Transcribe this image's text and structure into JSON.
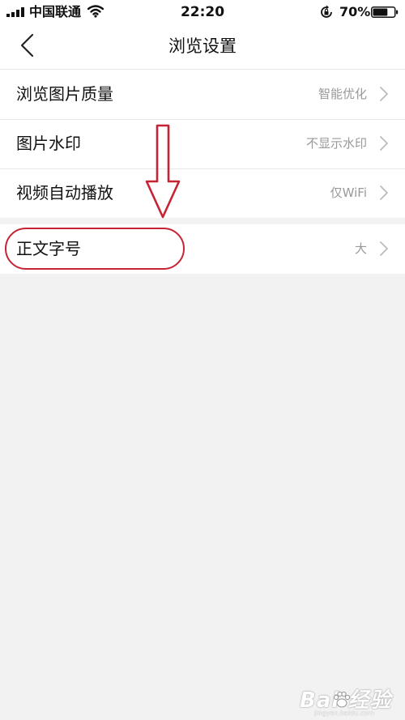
{
  "status_bar": {
    "carrier": "中国联通",
    "time": "22:20",
    "battery_percent": "70%",
    "battery_level": 0.7,
    "icons": [
      "signal-icon",
      "wifi-icon",
      "rotation-lock-icon",
      "battery-icon"
    ]
  },
  "header": {
    "title": "浏览设置",
    "back_icon": "chevron-left-icon"
  },
  "settings_groups": [
    [
      {
        "label": "浏览图片质量",
        "value": "智能优化"
      },
      {
        "label": "图片水印",
        "value": "不显示水印"
      },
      {
        "label": "视频自动播放",
        "value": "仅WiFi"
      }
    ],
    [
      {
        "label": "正文字号",
        "value": "大"
      }
    ]
  ],
  "annotation": {
    "arrow_icon": "down-arrow-icon",
    "highlight_shape": "ellipse",
    "color": "#c62434"
  },
  "watermark": {
    "brand": "Bai  经验",
    "url": "jingyan.baidu.com"
  },
  "colors": {
    "background": "#f2f2f2",
    "row_background": "#ffffff",
    "label_text": "#111111",
    "value_text": "#999999",
    "annotation_red": "#c62434"
  }
}
